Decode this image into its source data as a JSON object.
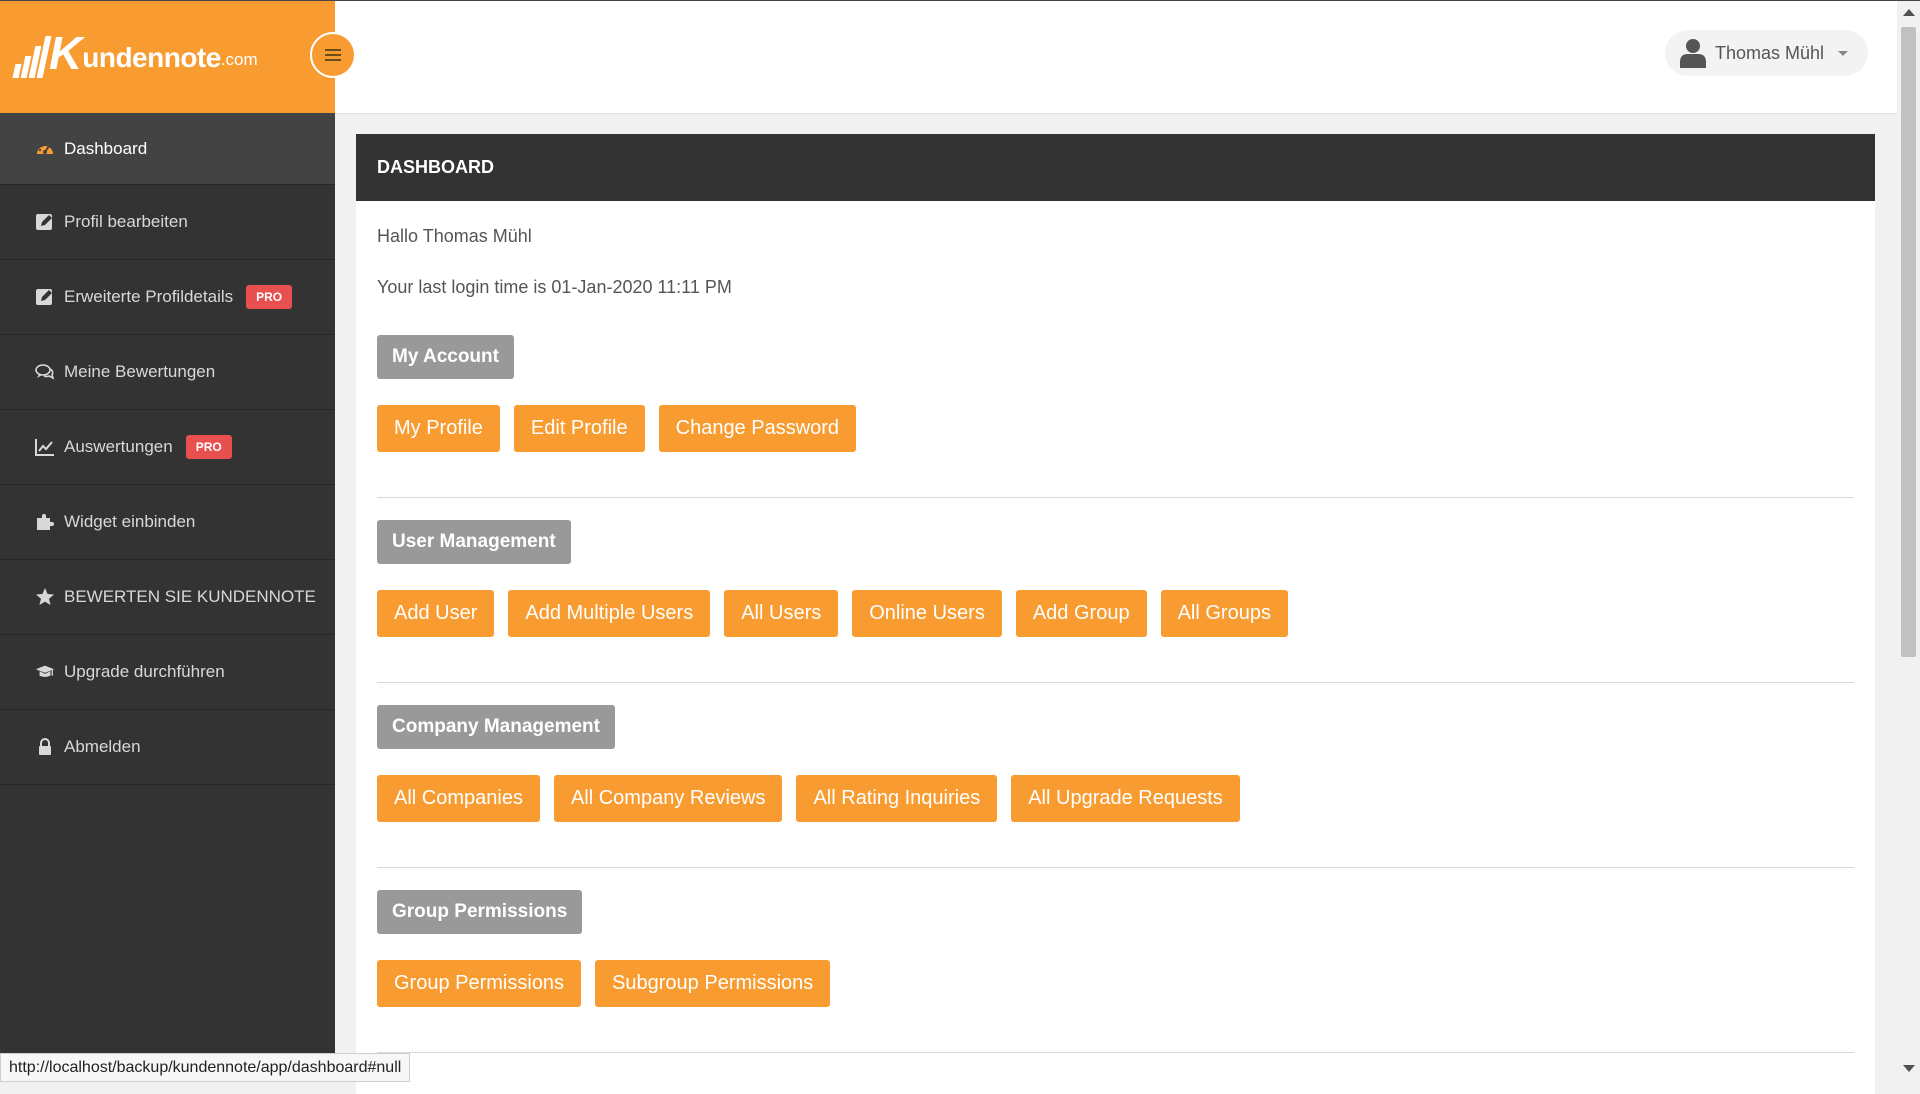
{
  "brand": {
    "logo_k": "K",
    "logo_text": "undennote",
    "logo_domain": ".com",
    "accent": "#f89c32"
  },
  "sidebar": {
    "items": [
      {
        "label": "Dashboard",
        "icon": "dashboard-icon",
        "active": true
      },
      {
        "label": "Profil bearbeiten",
        "icon": "edit-icon"
      },
      {
        "label": "Erweiterte Profildetails",
        "icon": "edit-icon",
        "badge": "PRO"
      },
      {
        "label": "Meine Bewertungen",
        "icon": "comments-icon"
      },
      {
        "label": "Auswertungen",
        "icon": "line-chart-icon",
        "badge": "PRO"
      },
      {
        "label": "Widget einbinden",
        "icon": "puzzle-icon"
      },
      {
        "label": "BEWERTEN SIE KUNDENNOTE",
        "icon": "star-icon"
      },
      {
        "label": "Upgrade durchführen",
        "icon": "graduation-cap-icon"
      },
      {
        "label": "Abmelden",
        "icon": "lock-icon"
      }
    ]
  },
  "header": {
    "user_name": "Thomas Mühl"
  },
  "panel": {
    "title": "DASHBOARD",
    "greeting": "Hallo Thomas Mühl",
    "last_login": "Your last login time is 01-Jan-2020 11:11 PM",
    "sections": [
      {
        "title": "My Account",
        "buttons": [
          "My Profile",
          "Edit Profile",
          "Change Password"
        ]
      },
      {
        "title": "User Management",
        "buttons": [
          "Add User",
          "Add Multiple Users",
          "All Users",
          "Online Users",
          "Add Group",
          "All Groups"
        ]
      },
      {
        "title": "Company Management",
        "buttons": [
          "All Companies",
          "All Company Reviews",
          "All Rating Inquiries",
          "All Upgrade Requests"
        ]
      },
      {
        "title": "Group Permissions",
        "buttons": [
          "Group Permissions",
          "Subgroup Permissions"
        ]
      }
    ]
  },
  "status_bar": {
    "url": "http://localhost/backup/kundennote/app/dashboard#null"
  }
}
